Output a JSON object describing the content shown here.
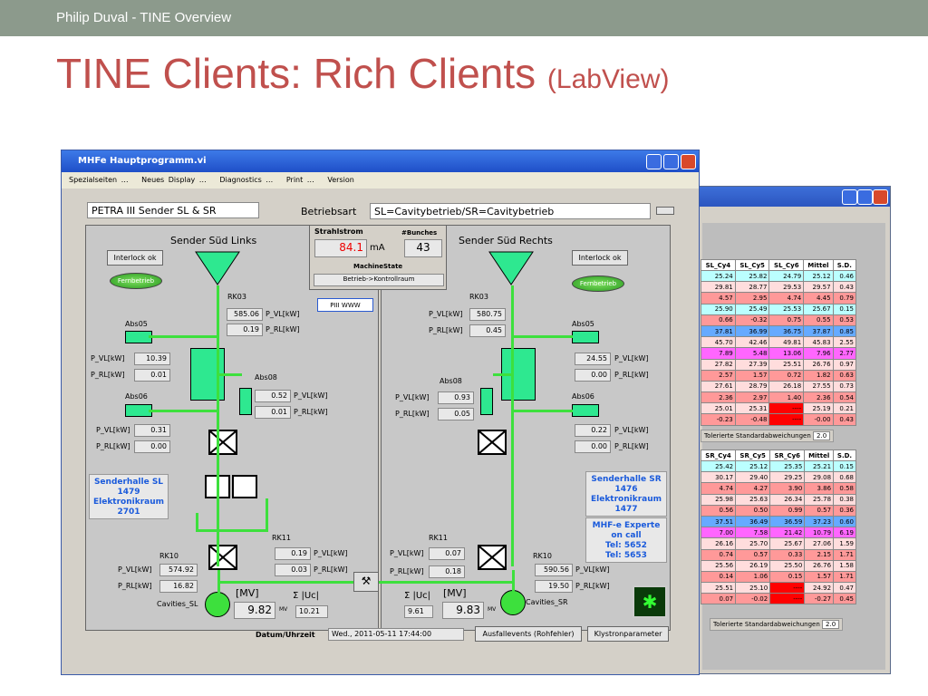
{
  "slide": {
    "header": "Philip Duval - TINE Overview",
    "title": "TINE Clients: Rich Clients",
    "title_sub": "(LabView)"
  },
  "window": {
    "title": "MHFe Hauptprogramm.vi",
    "menu": [
      "Spezialseiten …",
      "Neues Display …",
      "Diagnostics …",
      "Print …",
      "Version"
    ]
  },
  "panel": {
    "name": "PETRA III Sender SL & SR",
    "betriebsart_label": "Betriebsart",
    "betriebsart_value": "SL=Cavitybetrieb/SR=Cavitybetrieb",
    "strahlstrom_label": "Strahlstrom",
    "strahlstrom_value": "84.1",
    "strahlstrom_unit": "mA",
    "bunches_label": "#Bunches",
    "bunches_value": "43",
    "machinestate_label": "MachineState",
    "machinestate_value": "Betrieb->Kontrollraum",
    "piii_button": "PIII WWW",
    "datum_label": "Datum/Uhrzeit",
    "datum_value": "Wed., 2011-05-11 17:44:00",
    "ausfall_button": "Ausfallevents (Rohfehler)",
    "klystron_button": "Klystronparameter"
  },
  "left": {
    "title": "Sender Süd Links",
    "interlock": "Interlock ok",
    "fern": "Fernbetrieb",
    "rk03": "RK03",
    "rk03_pvl": "585.06",
    "rk03_prl": "0.19",
    "abs05": "Abs05",
    "abs05_pvl": "10.39",
    "abs05_prl": "0.01",
    "abs08": "Abs08",
    "abs08_pvl": "0.52",
    "abs08_prl": "0.01",
    "abs06": "Abs06",
    "abs06_pvl": "0.31",
    "abs06_prl": "0.00",
    "hall": [
      "Senderhalle SL",
      "1479",
      "Elektronikraum",
      "2701"
    ],
    "rk11": "RK11",
    "rk11_pvl": "0.19",
    "rk11_prl": "0.03",
    "rk10": "RK10",
    "rk10_pvl": "574.92",
    "rk10_prl": "16.82",
    "mv_label": "[MV]",
    "mv_value": "9.82",
    "mv_unit": "MV",
    "sum_label": "Σ |Uc|",
    "sum_value": "10.21",
    "cavities": "Cavities_SL"
  },
  "right": {
    "title": "Sender Süd Rechts",
    "interlock": "Interlock ok",
    "fern": "Fernbetrieb",
    "rk03": "RK03",
    "rk03_pvl": "580.75",
    "rk03_prl": "0.45",
    "abs05": "Abs05",
    "abs05_pvl": "24.55",
    "abs05_prl": "0.00",
    "abs08": "Abs08",
    "abs08_pvl": "0.93",
    "abs08_prl": "0.05",
    "abs06": "Abs06",
    "abs06_pvl": "0.22",
    "abs06_prl": "0.00",
    "hall": [
      "Senderhalle SR",
      "1476",
      "Elektronikraum",
      "1477"
    ],
    "expert": [
      "MHF-e Experte",
      "on call",
      "Tel: 5652",
      "Tel: 5653"
    ],
    "rk11": "RK11",
    "rk11_pvl": "0.07",
    "rk11_prl": "0.18",
    "rk10": "RK10",
    "rk10_pvl": "590.56",
    "rk10_prl": "19.50",
    "mv_label": "[MV]",
    "mv_value": "9.83",
    "mv_unit": "MV",
    "sum_label": "Σ |Uc|",
    "sum_value": "9.61",
    "cavities": "Cavities_SR"
  },
  "units": {
    "pvl": "P_VL[kW]",
    "prl": "P_RL[kW]"
  },
  "table1": {
    "headers": [
      "SL_Cy4",
      "SL_Cy5",
      "SL_Cy6",
      "Mittel",
      "S.D."
    ],
    "rows": [
      [
        "25.24",
        "25.82",
        "24.79",
        "25.12",
        "0.46"
      ],
      [
        "29.81",
        "28.77",
        "29.53",
        "29.57",
        "0.43"
      ],
      [
        "4.57",
        "2.95",
        "4.74",
        "4.45",
        "0.79"
      ],
      [
        "25.90",
        "25.49",
        "25.53",
        "25.67",
        "0.15"
      ],
      [
        "0.66",
        "-0.32",
        "0.75",
        "0.55",
        "0.53"
      ],
      [
        "37.81",
        "36.99",
        "36.75",
        "37.87",
        "0.85"
      ],
      [
        "45.70",
        "42.46",
        "49.81",
        "45.83",
        "2.55"
      ],
      [
        "7.89",
        "5.48",
        "13.06",
        "7.96",
        "2.77"
      ],
      [
        "27.82",
        "27.39",
        "25.51",
        "26.76",
        "0.97"
      ],
      [
        "2.57",
        "1.57",
        "0.72",
        "1.82",
        "0.63"
      ],
      [
        "27.61",
        "28.79",
        "26.18",
        "27.55",
        "0.73"
      ],
      [
        "2.36",
        "2.97",
        "1.40",
        "2.36",
        "0.54"
      ],
      [
        "25.01",
        "25.31",
        "----",
        "25.19",
        "0.21"
      ],
      [
        "-0.23",
        "-0.48",
        "----",
        "-0.00",
        "0.43"
      ]
    ],
    "tol_label": "Tolerierte Standardabweichungen",
    "tol_value": "2.0"
  },
  "table2": {
    "headers": [
      "SR_Cy4",
      "SR_Cy5",
      "SR_Cy6",
      "Mittel",
      "S.D."
    ],
    "rows": [
      [
        "25.42",
        "25.12",
        "25.35",
        "25.21",
        "0.15"
      ],
      [
        "30.17",
        "29.40",
        "29.25",
        "29.08",
        "0.68"
      ],
      [
        "4.74",
        "4.27",
        "3.90",
        "3.86",
        "0.58"
      ],
      [
        "25.98",
        "25.63",
        "26.34",
        "25.78",
        "0.38"
      ],
      [
        "0.56",
        "0.50",
        "0.99",
        "0.57",
        "0.36"
      ],
      [
        "37.51",
        "36.49",
        "36.59",
        "37.23",
        "0.60"
      ],
      [
        "7.00",
        "7.58",
        "21.42",
        "10.79",
        "6.19"
      ],
      [
        "26.16",
        "25.70",
        "25.67",
        "27.06",
        "1.59"
      ],
      [
        "0.74",
        "0.57",
        "0.33",
        "2.15",
        "1.71"
      ],
      [
        "25.56",
        "26.19",
        "25.50",
        "26.76",
        "1.58"
      ],
      [
        "0.14",
        "1.06",
        "0.15",
        "1.57",
        "1.71"
      ],
      [
        "25.51",
        "25.10",
        "----",
        "24.92",
        "0.47"
      ],
      [
        "0.07",
        "-0.02",
        "----",
        "-0.27",
        "0.45"
      ]
    ],
    "tol_label": "Tolerierte Standardabweichungen",
    "tol_value": "2.0"
  },
  "row_colors": [
    "#bff",
    "#fdd",
    "#f99",
    "#bff",
    "#f99",
    "#6af",
    "#fdd",
    "#f6f",
    "#fdd",
    "#f99",
    "#fdd",
    "#f99",
    "#fdd",
    "#f99"
  ],
  "row_colors2": [
    "#bff",
    "#fdd",
    "#f99",
    "#fdd",
    "#f99",
    "#6af",
    "#f6f",
    "#fdd",
    "#f99",
    "#fdd",
    "#f99",
    "#fdd",
    "#f99"
  ]
}
